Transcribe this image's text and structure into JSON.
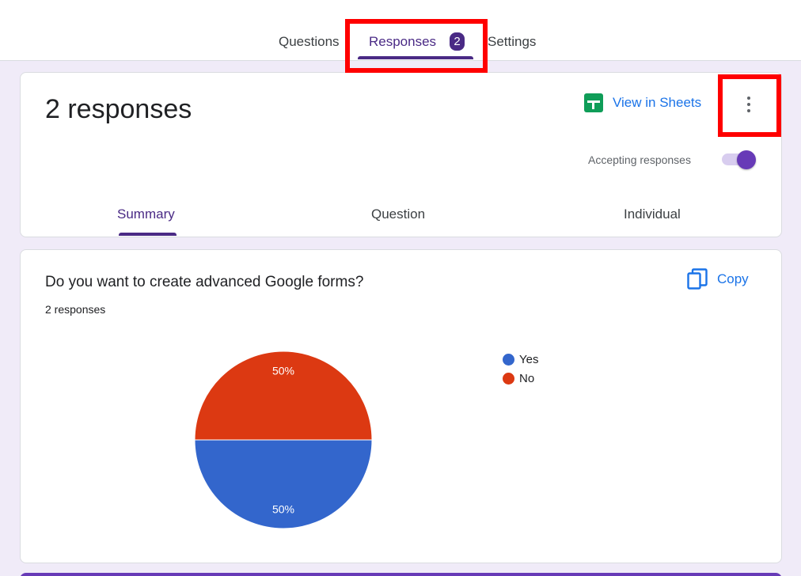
{
  "top_tabs": {
    "questions": "Questions",
    "responses": "Responses",
    "responses_count": "2",
    "settings": "Settings"
  },
  "header": {
    "title": "2 responses",
    "view_in_sheets": "View in Sheets",
    "accepting_label": "Accepting responses",
    "accepting_on": true
  },
  "sub_tabs": {
    "summary": "Summary",
    "question": "Question",
    "individual": "Individual"
  },
  "question_card": {
    "title": "Do you want to create advanced Google forms?",
    "count": "2 responses",
    "copy_label": "Copy"
  },
  "colors": {
    "accent": "#4a2a85",
    "highlight": "#ff0000",
    "yes": "#3366cc",
    "no": "#dc3912"
  },
  "icons": [
    "sheets-icon",
    "more-vert-icon",
    "copy-icon"
  ],
  "chart_data": {
    "type": "pie",
    "categories": [
      "Yes",
      "No"
    ],
    "values": [
      50,
      50
    ],
    "labels": [
      "50%",
      "50%"
    ],
    "colors": [
      "#3366cc",
      "#dc3912"
    ],
    "legend_position": "right"
  }
}
